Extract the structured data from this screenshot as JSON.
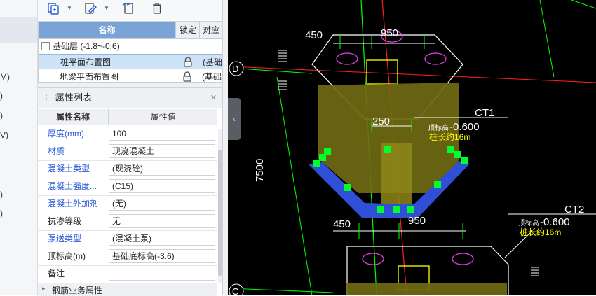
{
  "left_strip": {
    "fragments": [
      "M)",
      ")",
      ")",
      "V)",
      ")",
      ")"
    ]
  },
  "toolbar": {
    "icons": [
      "copy-layer-icon",
      "edit-icon",
      "refresh-icon",
      "delete-icon"
    ]
  },
  "layer_table": {
    "columns": {
      "name": "名称",
      "lock": "锁定",
      "corr": "对应"
    },
    "group": {
      "toggle": "−",
      "label": "基础层 (-1.8~-0.6)"
    },
    "rows": [
      {
        "label": "桩平面布置图",
        "corr": "(基础"
      },
      {
        "label": "地梁平面布置图",
        "corr": "(基础"
      }
    ]
  },
  "properties": {
    "title": "属性列表",
    "close": "×",
    "header_name": "属性名称",
    "header_value": "属性值",
    "rows": [
      {
        "name": "厚度(mm)",
        "value": "100",
        "blue": true
      },
      {
        "name": "材质",
        "value": "现浇混凝土",
        "blue": true
      },
      {
        "name": "混凝土类型",
        "value": "(现浇砼)",
        "blue": true
      },
      {
        "name": "混凝土强度...",
        "value": "(C15)",
        "blue": true
      },
      {
        "name": "混凝土外加剂",
        "value": "(无)",
        "blue": true
      },
      {
        "name": "抗渗等级",
        "value": "无",
        "blue": false
      },
      {
        "name": "泵送类型",
        "value": "(混凝土泵)",
        "blue": true
      },
      {
        "name": "顶标高(m)",
        "value": "基础底标高(-3.6)",
        "blue": false
      },
      {
        "name": "备注",
        "value": "",
        "blue": false
      }
    ],
    "footer": "钢筋业务属性"
  },
  "cad": {
    "dims": {
      "top_left": "450",
      "top_right": "950",
      "mid": "250",
      "bottom_left": "450",
      "bottom_right": "950",
      "vertical": "7500"
    },
    "axes": {
      "d": "D",
      "c": "C"
    },
    "callouts": [
      {
        "name": "CT1",
        "elev_label": "顶标高",
        "elev": "-0.600",
        "pile": "桩长约16m"
      },
      {
        "name": "CT2",
        "elev_label": "顶标高",
        "elev": "-0.600",
        "pile": "桩长约16m"
      }
    ],
    "colors": {
      "background": "#000000",
      "cap_fill": "#6f6a12",
      "cushion": "#2e4fd6",
      "grip": "#00ff2a",
      "grid": "#00ff00",
      "axis_red": "#ff2020",
      "pile_magenta": "#e040e0",
      "yellow_text": "#ffff00"
    }
  }
}
